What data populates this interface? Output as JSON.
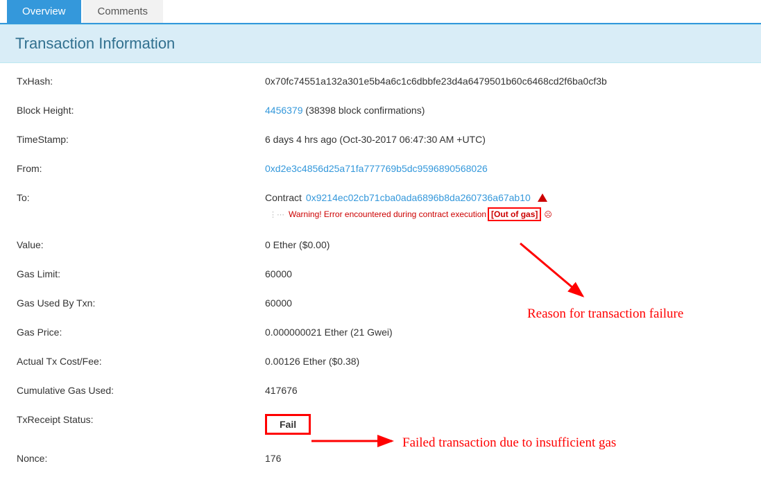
{
  "tabs": {
    "overview": "Overview",
    "comments": "Comments"
  },
  "panel_title": "Transaction Information",
  "rows": {
    "txhash": {
      "label": "TxHash:",
      "value": "0x70fc74551a132a301e5b4a6c1c6dbbfe23d4a6479501b60c6468cd2f6ba0cf3b"
    },
    "block_height": {
      "label": "Block Height:",
      "link": "4456379",
      "suffix": " (38398 block confirmations)"
    },
    "timestamp": {
      "label": "TimeStamp:",
      "value": "6 days 4 hrs ago (Oct-30-2017 06:47:30 AM +UTC)"
    },
    "from": {
      "label": "From:",
      "value": "0xd2e3c4856d25a71fa777769b5dc9596890568026"
    },
    "to": {
      "label": "To:",
      "prefix": "Contract ",
      "link": "0x9214ec02cb71cba0ada6896b8da260736a67ab10",
      "warning_text": "Warning! Error encountered during contract execution ",
      "warning_reason": "[Out of gas]"
    },
    "value": {
      "label": "Value:",
      "value": "0 Ether ($0.00)"
    },
    "gas_limit": {
      "label": "Gas Limit:",
      "value": "60000"
    },
    "gas_used": {
      "label": "Gas Used By Txn:",
      "value": "60000"
    },
    "gas_price": {
      "label": "Gas Price:",
      "value": "0.000000021 Ether (21 Gwei)"
    },
    "actual_cost": {
      "label": "Actual Tx Cost/Fee:",
      "value": "0.00126 Ether ($0.38)"
    },
    "cumulative": {
      "label": "Cumulative Gas Used:",
      "value": "417676"
    },
    "receipt_status": {
      "label": "TxReceipt Status:",
      "value": "Fail"
    },
    "nonce": {
      "label": "Nonce:",
      "value": "176"
    }
  },
  "annotations": {
    "reason": "Reason for transaction failure",
    "failed": "Failed transaction due to insufficient gas"
  }
}
